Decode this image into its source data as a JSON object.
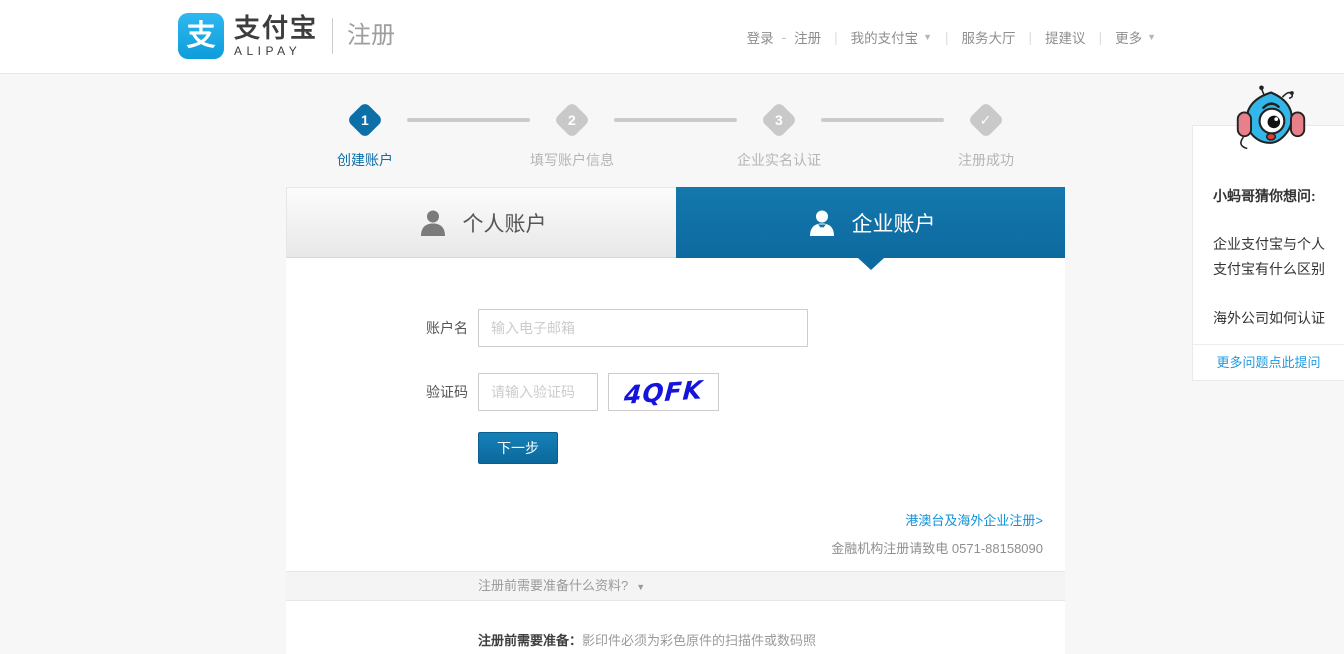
{
  "header": {
    "logo": {
      "icon_glyph": "支",
      "brand_cn": "支付宝",
      "brand_en": "ALIPAY",
      "page_title": "注册"
    },
    "nav": {
      "login": "登录",
      "dash": "-",
      "register": "注册",
      "separator": "|",
      "my_alipay": "我的支付宝",
      "service_hall": "服务大厅",
      "suggestions": "提建议",
      "more": "更多"
    }
  },
  "icons": {
    "caret": "▼",
    "check": "✓"
  },
  "steps": {
    "items": [
      {
        "num": "1",
        "label": "创建账户",
        "active": true
      },
      {
        "num": "2",
        "label": "填写账户信息",
        "active": false
      },
      {
        "num": "3",
        "label": "企业实名认证",
        "active": false
      },
      {
        "num": "✓",
        "label": "注册成功",
        "active": false
      }
    ]
  },
  "tabs": {
    "personal": {
      "label": "个人账户"
    },
    "enterprise": {
      "label": "企业账户",
      "selected": true
    }
  },
  "form": {
    "account": {
      "label": "账户名",
      "placeholder": "输入电子邮箱",
      "value": ""
    },
    "captcha": {
      "label": "验证码",
      "placeholder": "请输入验证码",
      "value": "",
      "code": "4QFK"
    },
    "next_button": "下一步"
  },
  "links": {
    "overseas": "港澳台及海外企业注册>",
    "finance_text": "金融机构注册请致电",
    "finance_phone": "0571-88158090"
  },
  "accordion": {
    "question": "注册前需要准备什么资料?"
  },
  "prep": {
    "label": "注册前需要准备：",
    "text": "影印件必须为彩色原件的扫描件或数码照"
  },
  "help": {
    "title": "小蚂哥猜你想问:",
    "question1": "企业支付宝与个人支付宝有什么区别",
    "question2": "海外公司如何认证",
    "more_link": "更多问题点此提问"
  },
  "colors": {
    "brand_blue": "#0d6fa8",
    "tab_blue": "#0e6da3",
    "link_blue": "#1092d8",
    "captcha_blue": "#1414dd",
    "logo_blue": "#1aa5e1",
    "page_bg": "#f7f7f7"
  }
}
